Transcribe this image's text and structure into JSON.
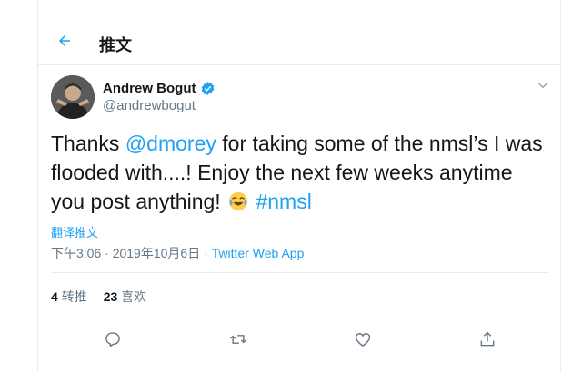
{
  "colors": {
    "accent": "#1da1f2",
    "muted": "#657786",
    "text": "#14171a",
    "border": "#e6ecf0"
  },
  "header": {
    "title": "推文",
    "back_icon": "left-arrow"
  },
  "author": {
    "name": "Andrew Bogut",
    "handle": "@andrewbogut",
    "verified": true
  },
  "tweet": {
    "t1": "Thanks ",
    "mention": "@dmorey",
    "t2": " for taking some of the nmsl’s I was flooded with....! Enjoy the next few weeks anytime you post anything! ",
    "emoji": "face-with-tears-of-joy",
    "hashtag": "#nmsl"
  },
  "translate_label": "翻译推文",
  "meta": {
    "time": "下午3:06",
    "date": "2019年10月6日",
    "app": "Twitter Web App"
  },
  "stats": {
    "retweets_count": "4",
    "retweets_label": "转推",
    "likes_count": "23",
    "likes_label": "喜欢"
  },
  "actions": [
    "reply-icon",
    "retweet-icon",
    "like-icon",
    "share-icon"
  ]
}
